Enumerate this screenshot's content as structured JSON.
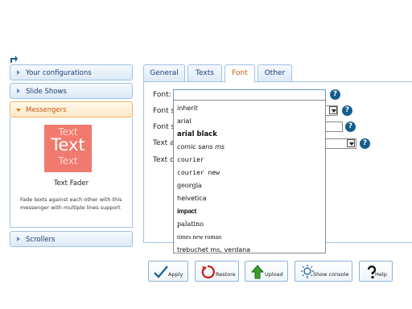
{
  "sidebar": {
    "items": [
      {
        "label": "Your configurations"
      },
      {
        "label": "Slide Shows"
      },
      {
        "label": "Messengers"
      },
      {
        "label": "Scrollers"
      }
    ],
    "expanded": {
      "thumb_lines": [
        "Text",
        "Text",
        "Text"
      ],
      "title": "Text Fader",
      "description": "Fade texts against each other with this messenger with multiple lines support"
    }
  },
  "tabs": [
    {
      "label": "General"
    },
    {
      "label": "Texts"
    },
    {
      "label": "Font"
    },
    {
      "label": "Other"
    }
  ],
  "form": {
    "labels": [
      "Font:",
      "Font s",
      "Font s",
      "Text a",
      "Text c"
    ],
    "font_value": ""
  },
  "dropdown": {
    "options": [
      "inherit",
      "arial",
      "arial black",
      "comic sans ms",
      "courier",
      "courier new",
      "georgia",
      "helvetica",
      "impact",
      "palatino",
      "times new roman",
      "trebuchet ms, verdana"
    ]
  },
  "help_glyph": "?",
  "buttons": {
    "apply": "Apply",
    "restore": "Restore",
    "upload": "Upload",
    "show_console": "Show console",
    "help": "Help"
  },
  "colors": {
    "accent": "#155e8c",
    "active_tab": "#c55a0b",
    "thumb": "#f07a6e"
  }
}
